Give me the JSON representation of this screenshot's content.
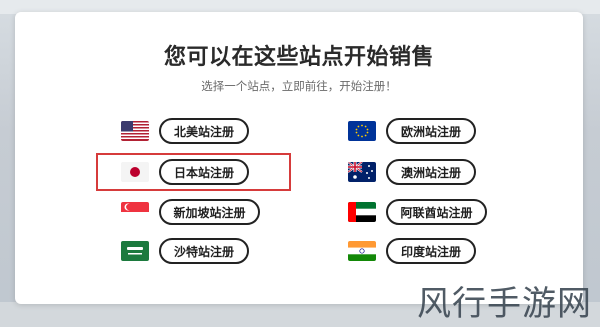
{
  "modal": {
    "title": "您可以在这些站点开始销售",
    "subtitle": "选择一个站点，立即前往，开始注册！"
  },
  "sites": [
    {
      "label": "北美站注册",
      "flag": "us-flag-icon"
    },
    {
      "label": "日本站注册",
      "flag": "japan-flag-icon"
    },
    {
      "label": "新加坡站注册",
      "flag": "singapore-flag-icon"
    },
    {
      "label": "沙特站注册",
      "flag": "saudi-flag-icon"
    },
    {
      "label": "欧洲站注册",
      "flag": "eu-flag-icon"
    },
    {
      "label": "澳洲站注册",
      "flag": "australia-flag-icon"
    },
    {
      "label": "阿联酋站注册",
      "flag": "uae-flag-icon"
    },
    {
      "label": "印度站注册",
      "flag": "india-flag-icon"
    }
  ],
  "highlight_color": "#d63b3b",
  "watermark": "风行手游网"
}
